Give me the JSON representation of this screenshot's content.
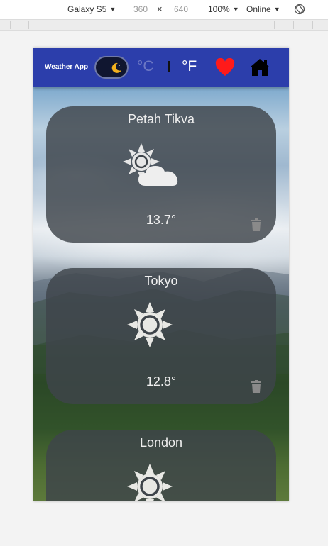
{
  "devtools": {
    "device": "Galaxy S5",
    "width": "360",
    "times": "×",
    "height": "640",
    "zoom": "100%",
    "network": "Online",
    "rotate_icon": "rotate-icon"
  },
  "app": {
    "brand": "Weather App",
    "dark_mode_icon": "moon-icon",
    "unit_celsius": "°C",
    "unit_fahrenheit": "°F",
    "favorites_icon": "heart-icon",
    "home_icon": "home-icon",
    "accent_color": "#2c3eab",
    "heart_color": "#ff1a1a"
  },
  "cards": [
    {
      "city": "Petah Tikva",
      "condition_icon": "partly-cloudy-icon",
      "temp": "13.7°",
      "delete_icon": "trash-icon"
    },
    {
      "city": "Tokyo",
      "condition_icon": "sun-icon",
      "temp": "12.8°",
      "delete_icon": "trash-icon"
    },
    {
      "city": "London",
      "condition_icon": "sun-icon",
      "temp": "",
      "delete_icon": "trash-icon"
    }
  ]
}
